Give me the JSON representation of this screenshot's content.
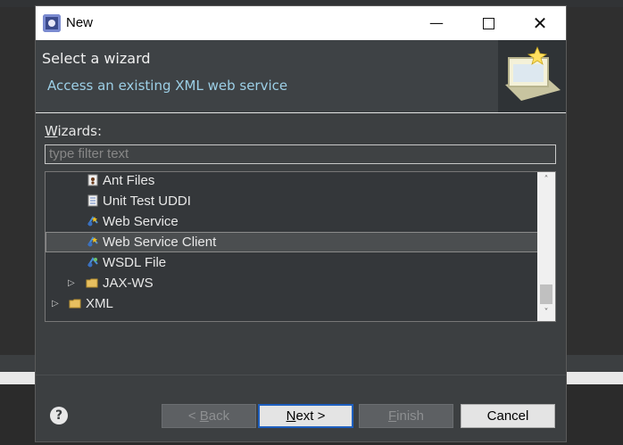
{
  "dialog": {
    "title": "New",
    "header_title": "Select a wizard",
    "header_subtitle": "Access an existing XML web service",
    "wizards_label_prefix": "W",
    "wizards_label_rest": "izards:",
    "filter_placeholder": "type filter text"
  },
  "tree": {
    "items": [
      {
        "label": "Ant Files",
        "icon": "ant-file-icon",
        "level": 2
      },
      {
        "label": "Unit Test UDDI",
        "icon": "document-icon",
        "level": 2
      },
      {
        "label": "Web Service",
        "icon": "web-service-icon",
        "level": 2
      },
      {
        "label": "Web Service Client",
        "icon": "web-service-client-icon",
        "level": 2,
        "selected": true
      },
      {
        "label": "WSDL File",
        "icon": "wsdl-icon",
        "level": 2
      },
      {
        "label": "JAX-WS",
        "icon": "folder-icon",
        "level": 1,
        "expandable": true
      },
      {
        "label": "XML",
        "icon": "folder-icon",
        "level": 0,
        "expandable": true
      }
    ]
  },
  "buttons": {
    "back_prefix": "< ",
    "back_u": "B",
    "back_rest": "ack",
    "next_u": "N",
    "next_rest": "ext >",
    "finish_u": "F",
    "finish_rest": "inish",
    "cancel": "Cancel",
    "help": "?"
  },
  "colors": {
    "dialog_bg": "#3c3f41",
    "subtitle": "#9ccfe6",
    "next_border": "#1e5fbf"
  }
}
